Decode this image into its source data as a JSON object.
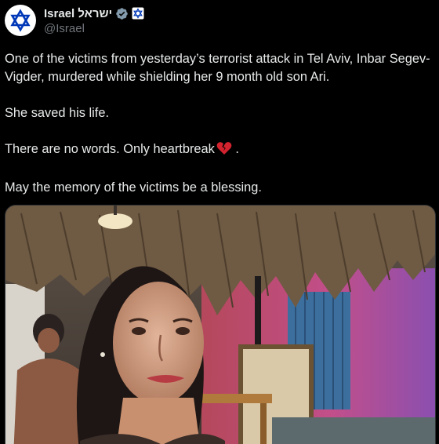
{
  "author": {
    "display_name": "Israel ישראל",
    "handle": "@Israel",
    "avatar_icon": "star-of-david-icon",
    "verified_icon": "verified-badge-icon",
    "affiliate_icon": "government-affiliate-icon"
  },
  "tweet": {
    "paragraphs": [
      "One of the victims from yesterday’s terrorist attack in Tel Aviv,  Inbar Segev-Vigder, murdered while shielding her 9 month old son Ari.",
      "She saved his life.",
      "There are no words. Only heartbreak",
      "May the memory of the victims be a blessing."
    ],
    "heart_suffix": " .",
    "emoji": "broken-heart-icon"
  },
  "colors": {
    "background": "#000000",
    "text": "#e7e9ea",
    "secondary": "#71767b",
    "verified": "#829aab",
    "brand_blue": "#0038b8"
  }
}
